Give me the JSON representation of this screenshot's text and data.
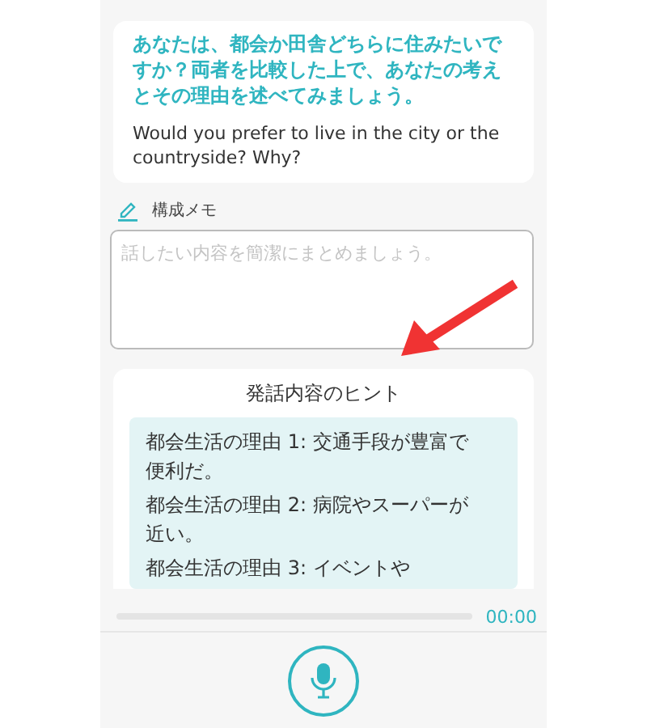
{
  "question": {
    "japanese": "あなたは、都会か田舎どちらに住みたいですか？両者を比較した上で、あなたの考えとその理由を述べてみましょう。",
    "english": "Would you prefer to live in the city or the countryside? Why?"
  },
  "memo": {
    "label": "構成メモ",
    "placeholder": "話したい内容を簡潔にまとめましょう。"
  },
  "hints": {
    "title": "発話内容のヒント",
    "items": [
      "都会生活の理由 1: 交通手段が豊富で便利だ。",
      "都会生活の理由 2: 病院やスーパーが近い。",
      "都会生活の理由 3: イベントや"
    ]
  },
  "recorder": {
    "level": 0,
    "time": "00:00"
  }
}
